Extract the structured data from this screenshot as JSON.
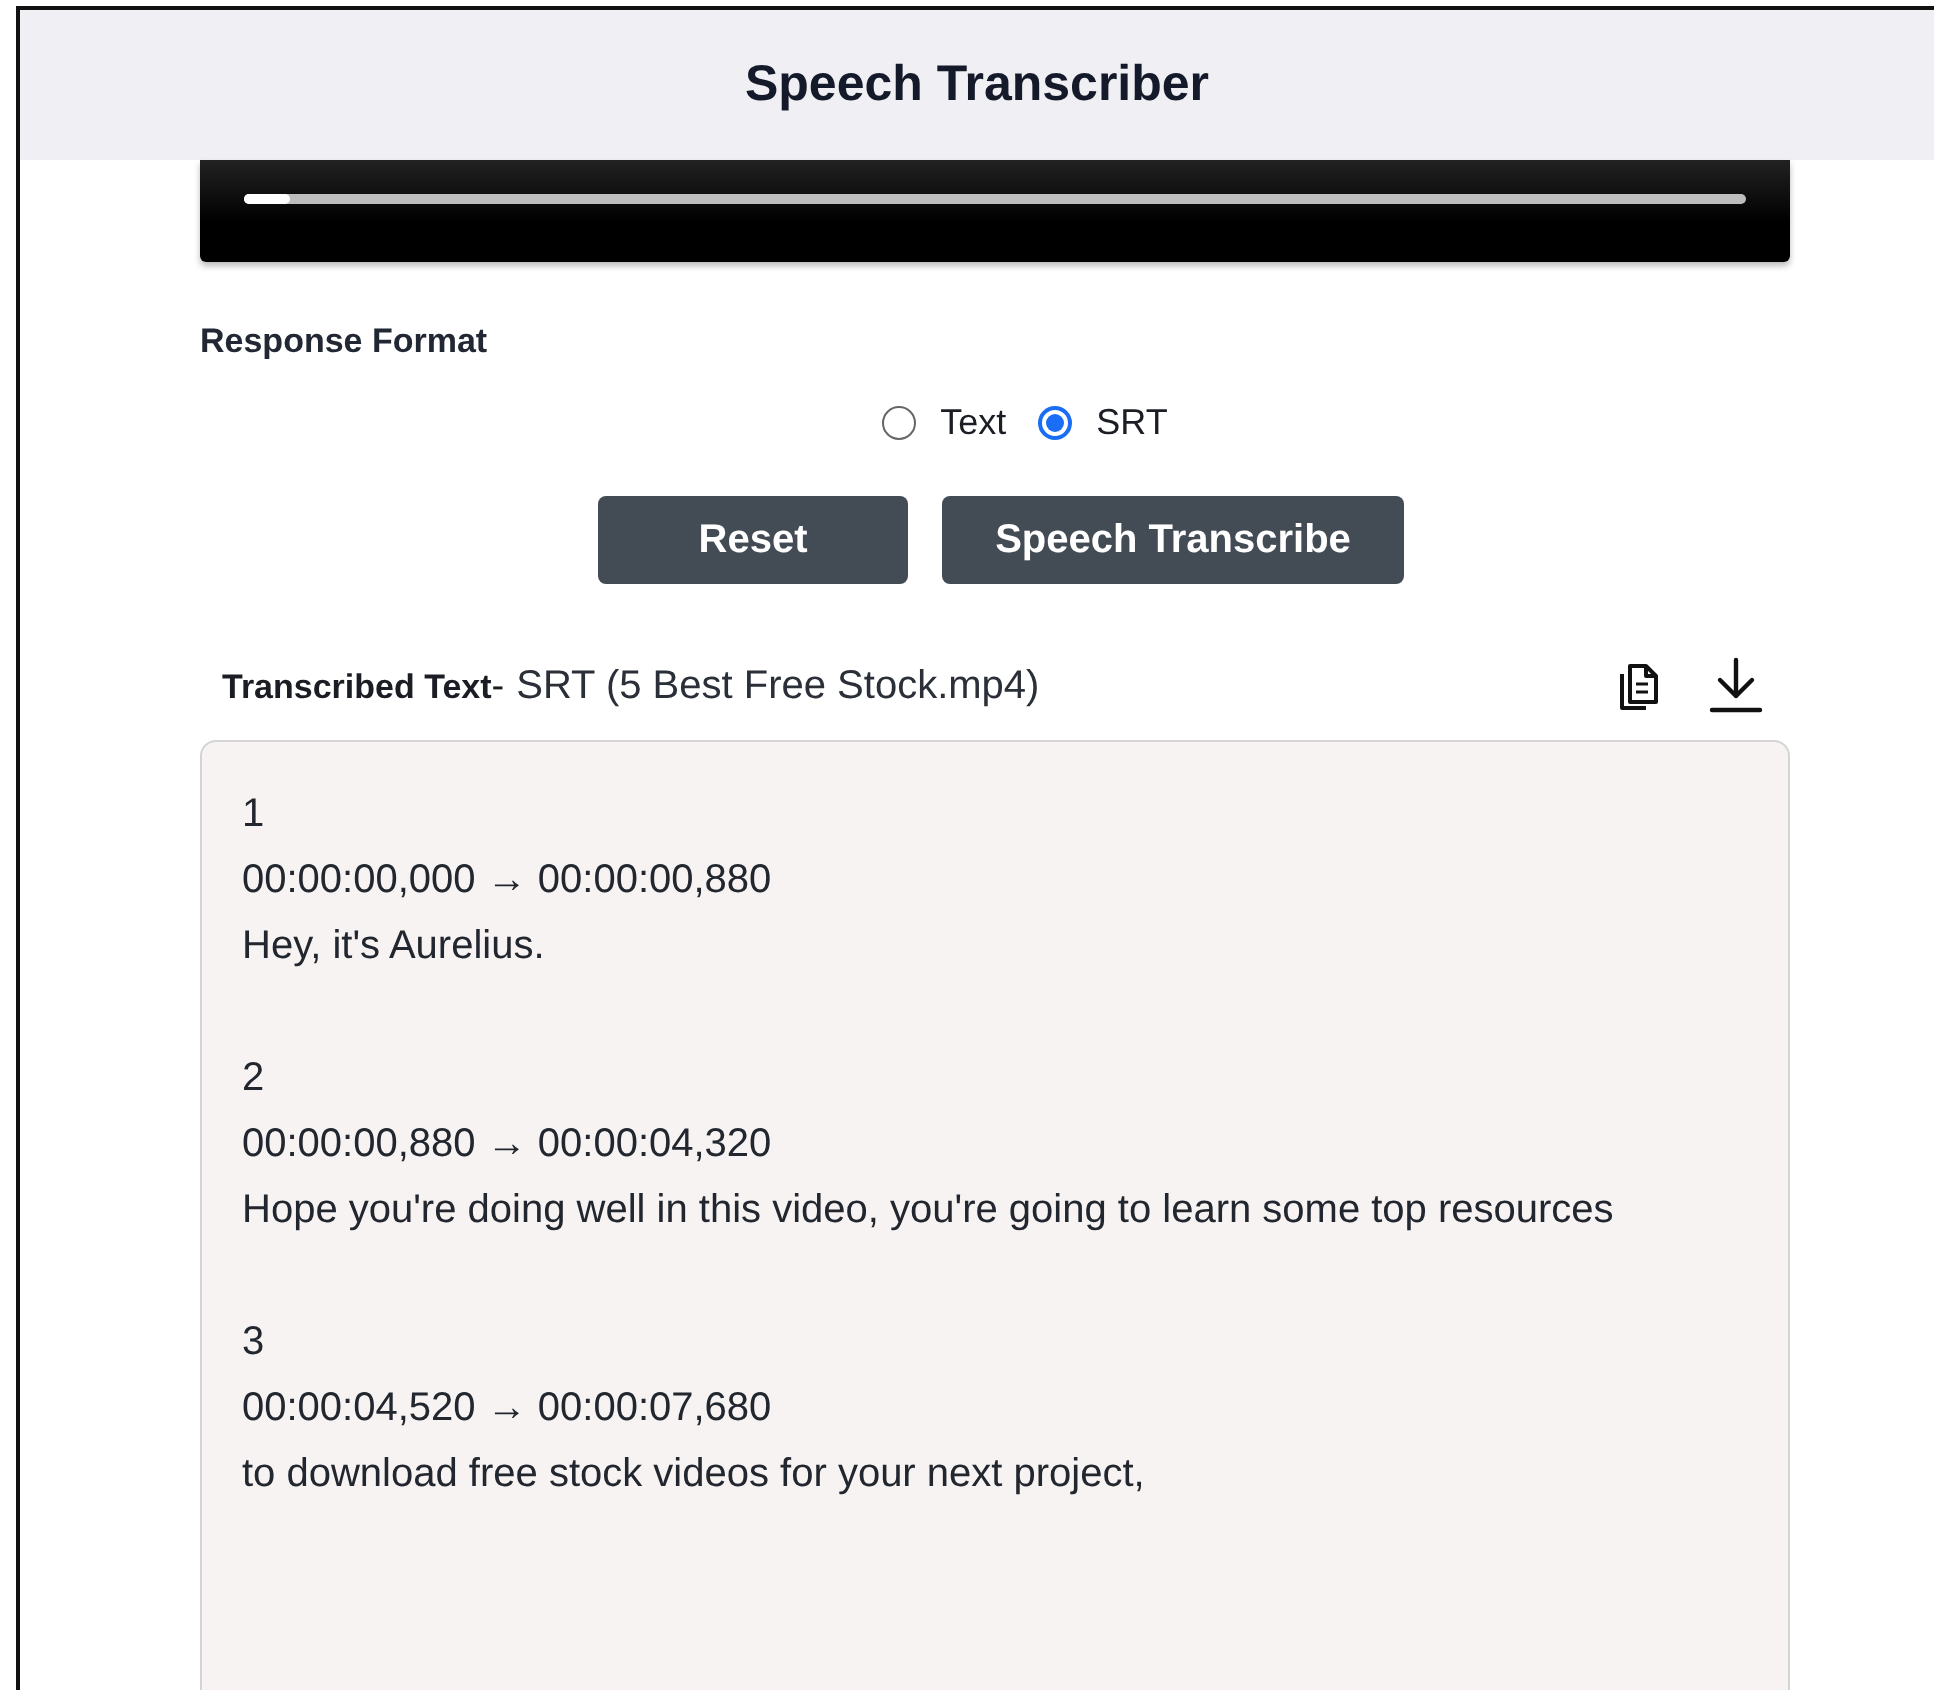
{
  "header": {
    "title": "Speech Transcriber"
  },
  "player": {
    "progress": {
      "level": 0.03
    }
  },
  "response_format": {
    "label": "Response Format",
    "options": [
      {
        "label": "Text",
        "selected": false
      },
      {
        "label": "SRT",
        "selected": true
      }
    ]
  },
  "buttons": [
    "Reset",
    "Speech Transcribe"
  ],
  "transcript": {
    "label": "Transcribed Text",
    "separator": "-",
    "title": "SRT (5 Best Free Stock.mp4)",
    "entries": [
      {
        "index": "1",
        "timing": "00:00:00,000 → 00:00:00,880",
        "text": "Hey, it's Aurelius."
      },
      {
        "index": "2",
        "timing": "00:00:00,880 → 00:00:04,320",
        "text": "Hope you're doing well in this video, you're going to learn some top resources"
      },
      {
        "index": "3",
        "timing": "00:00:04,520 → 00:00:07,680",
        "text": "to download free stock videos for your next project,"
      }
    ]
  }
}
